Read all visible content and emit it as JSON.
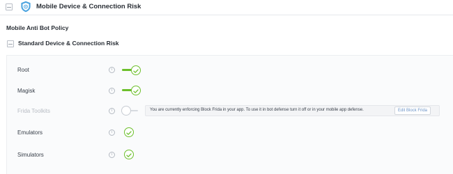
{
  "header": {
    "title": "Mobile Device & Connection Risk"
  },
  "policy": {
    "title": "Mobile Anti Bot Policy"
  },
  "subsection": {
    "title": "Standard Device & Connection Risk"
  },
  "rows": [
    {
      "label": "Root",
      "state": "on"
    },
    {
      "label": "Magisk",
      "state": "on"
    },
    {
      "label": "Frida Toolkits",
      "state": "off"
    },
    {
      "label": "Emulators",
      "state": "checked"
    },
    {
      "label": "Simulators",
      "state": "checked"
    }
  ],
  "notice": {
    "text": "You are currently enforcing Block Frida in your app. To use it in bot defense turn it off or in your mobile app defense.",
    "link": "Edit Block Frida"
  },
  "info_icon_glyph": "i",
  "colors": {
    "accent": "#6cbf2b",
    "shield": "#4aa3df"
  }
}
